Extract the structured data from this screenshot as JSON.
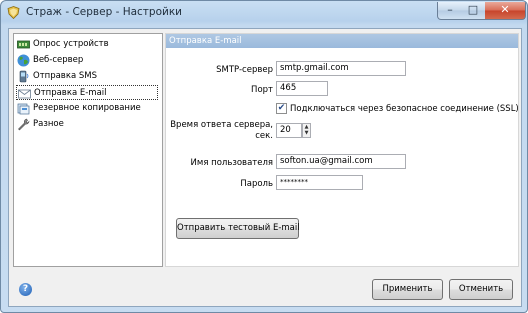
{
  "window": {
    "title": "Страж - Сервер - Настройки"
  },
  "sidebar": {
    "items": [
      {
        "label": "Опрос устройств",
        "icon": "device-poll-icon"
      },
      {
        "label": "Веб-сервер",
        "icon": "globe-icon"
      },
      {
        "label": "Отправка SMS",
        "icon": "sms-icon"
      },
      {
        "label": "Отправка E-mail",
        "icon": "envelope-icon",
        "selected": true
      },
      {
        "label": "Резервное копирование",
        "icon": "backup-icon"
      },
      {
        "label": "Разное",
        "icon": "wrench-icon"
      }
    ]
  },
  "panel": {
    "header": "Отправка E-mail",
    "smtp_label": "SMTP-сервер",
    "smtp_value": "smtp.gmail.com",
    "port_label": "Порт",
    "port_value": "465",
    "ssl_label": "Подключаться через безопасное соединение (SSL)",
    "ssl_checked": true,
    "timeout_label_1": "Время ответа сервера,",
    "timeout_label_2": "сек.",
    "timeout_value": "20",
    "user_label": "Имя пользователя",
    "user_value": "softon.ua@gmail.com",
    "password_label": "Пароль",
    "password_value": "********",
    "test_button": "Отправить тестовый E-mail"
  },
  "footer": {
    "apply_button": "Применить",
    "cancel_button": "Отменить"
  },
  "colors": {
    "header_bg": "#9ab9dc",
    "window_frame": "#c3d9ef",
    "close_button": "#c7432b"
  }
}
